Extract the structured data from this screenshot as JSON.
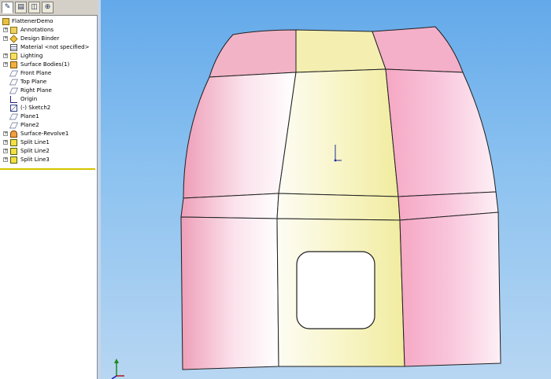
{
  "tabs": [
    {
      "name": "feature-manager-tab",
      "glyph": "✎",
      "active": true
    },
    {
      "name": "property-manager-tab",
      "glyph": "▤",
      "active": false
    },
    {
      "name": "configuration-manager-tab",
      "glyph": "◫",
      "active": false
    },
    {
      "name": "dimxpert-manager-tab",
      "glyph": "⊕",
      "active": false
    }
  ],
  "tree": {
    "root": "FlattenerDemo",
    "items": [
      {
        "label": "Annotations",
        "icon": "annotations-icon",
        "expand": true
      },
      {
        "label": "Design Binder",
        "icon": "design-binder-icon",
        "expand": true
      },
      {
        "label": "Material <not specified>",
        "icon": "material-icon",
        "expand": false
      },
      {
        "label": "Lighting",
        "icon": "lighting-icon",
        "expand": true
      },
      {
        "label": "Surface Bodies(1)",
        "icon": "surface-bodies-icon",
        "expand": true
      },
      {
        "label": "Front Plane",
        "icon": "plane-icon",
        "expand": false
      },
      {
        "label": "Top Plane",
        "icon": "plane-icon",
        "expand": false
      },
      {
        "label": "Right Plane",
        "icon": "plane-icon",
        "expand": false
      },
      {
        "label": "Origin",
        "icon": "origin-icon",
        "expand": false
      },
      {
        "label": "(-) Sketch2",
        "icon": "sketch-icon",
        "expand": false
      },
      {
        "label": "Plane1",
        "icon": "plane-icon",
        "expand": false
      },
      {
        "label": "Plane2",
        "icon": "plane-icon",
        "expand": false
      },
      {
        "label": "Surface-Revolve1",
        "icon": "surface-revolve-icon",
        "expand": true
      },
      {
        "label": "Split Line1",
        "icon": "split-line-icon",
        "expand": true
      },
      {
        "label": "Split Line2",
        "icon": "split-line-icon",
        "expand": true
      },
      {
        "label": "Split Line3",
        "icon": "split-line-icon",
        "expand": true
      }
    ]
  },
  "colors": {
    "background_top": "#63a9ea",
    "face_pink": "#f4a6c0",
    "face_yellow": "#f4f0a8",
    "edge": "#202020",
    "rollback_bar": "#d4c400"
  }
}
